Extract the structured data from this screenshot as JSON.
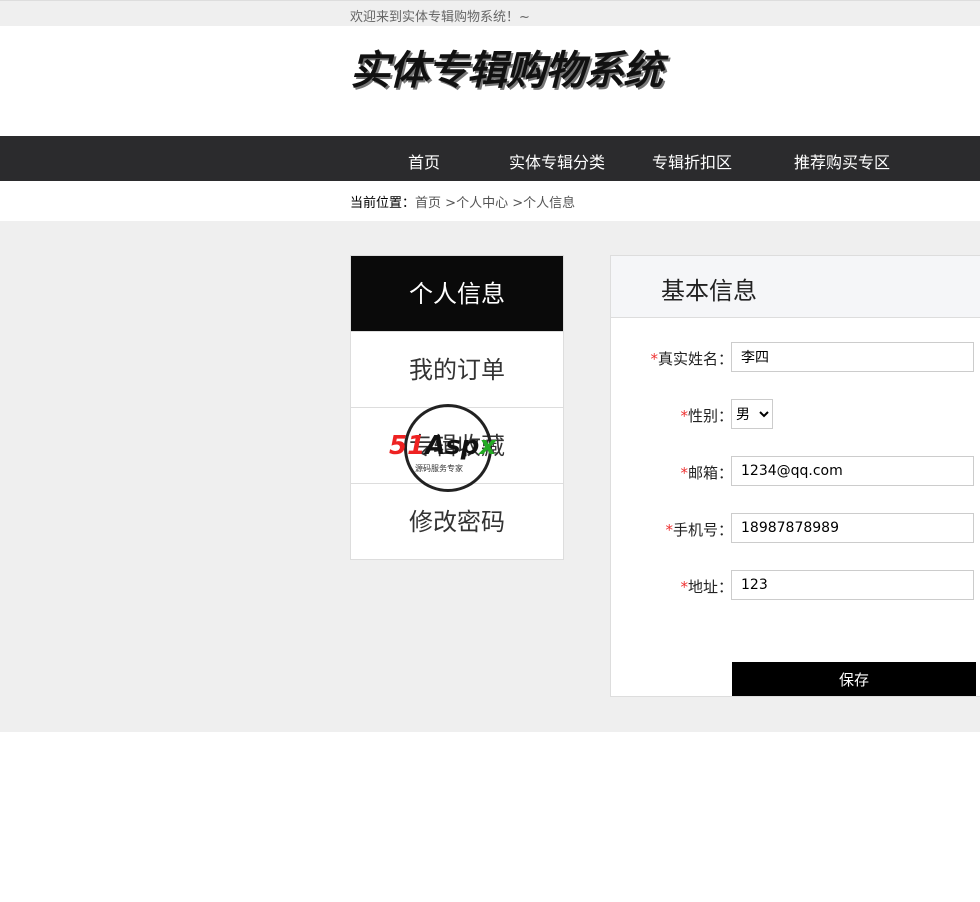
{
  "welcome": "欢迎来到实体专辑购物系统！~",
  "logo": "实体专辑购物系统",
  "nav": [
    "首页",
    "实体专辑分类",
    "专辑折扣区",
    "推荐购买专区"
  ],
  "breadcrumb": {
    "label": "当前位置：",
    "items": [
      "首页",
      ">个人中心",
      ">个人信息"
    ]
  },
  "sidebar": [
    "个人信息",
    "我的订单",
    "专辑收藏",
    "修改密码"
  ],
  "panel": {
    "title": "基本信息",
    "fields": [
      {
        "label": "真实姓名：",
        "value": "李四"
      },
      {
        "label": "性别：",
        "value": "男"
      },
      {
        "label": "邮箱：",
        "value": "1234@qq.com"
      },
      {
        "label": "手机号：",
        "value": "18987878989"
      },
      {
        "label": "地址：",
        "value": "123"
      }
    ],
    "required_mark": "*",
    "save": "保存"
  },
  "watermark": {
    "brand": "51Aspx",
    "tagline": "源码服务专家"
  }
}
